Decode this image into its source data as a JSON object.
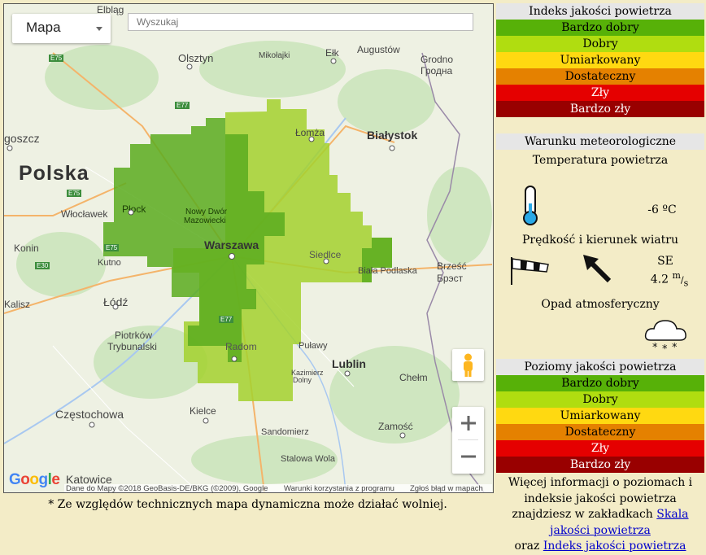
{
  "map": {
    "type_selector": "Mapa",
    "search_placeholder": "Wyszukaj",
    "logo": "Google",
    "attribution": {
      "data": "Dane do Mapy ©2018 GeoBasis-DE/BKG (©2009), Google",
      "terms": "Warunki korzystania z programu",
      "report": "Zgłoś błąd w mapach"
    },
    "places": [
      {
        "id": "elblag",
        "name": "Elbląg"
      },
      {
        "id": "olsztyn",
        "name": "Olsztyn"
      },
      {
        "id": "mikolajki",
        "name": "Mikołajki"
      },
      {
        "id": "elk",
        "name": "Ełk"
      },
      {
        "id": "augustow",
        "name": "Augustów"
      },
      {
        "id": "grodno",
        "name": "Grodno"
      },
      {
        "id": "grodno_by",
        "name": "Гродна"
      },
      {
        "id": "lomza",
        "name": "Łomża"
      },
      {
        "id": "bialystok",
        "name": "Białystok"
      },
      {
        "id": "bydgoszcz",
        "name": "goszcz"
      },
      {
        "id": "polska",
        "name": "Polska"
      },
      {
        "id": "wloclawek",
        "name": "Włocławek"
      },
      {
        "id": "plock",
        "name": "Płock"
      },
      {
        "id": "nowydwor",
        "name": "Nowy Dwór"
      },
      {
        "id": "mazowiecki",
        "name": "Mazowiecki"
      },
      {
        "id": "warszawa",
        "name": "Warszawa"
      },
      {
        "id": "siedlce",
        "name": "Siedlce"
      },
      {
        "id": "biala",
        "name": "Biała Podlaska"
      },
      {
        "id": "brzesc",
        "name": "Brześć"
      },
      {
        "id": "brest",
        "name": "Брэст"
      },
      {
        "id": "konin",
        "name": "Konin"
      },
      {
        "id": "kutno",
        "name": "Kutno"
      },
      {
        "id": "kalisz",
        "name": "Kalisz"
      },
      {
        "id": "lodz",
        "name": "Łódź"
      },
      {
        "id": "piotrkow",
        "name": "Piotrków"
      },
      {
        "id": "trybunalski",
        "name": "Trybunalski"
      },
      {
        "id": "radom",
        "name": "Radom"
      },
      {
        "id": "pulawy",
        "name": "Puławy"
      },
      {
        "id": "kazimierz",
        "name": "Kazimierz"
      },
      {
        "id": "dolny",
        "name": "Dolny"
      },
      {
        "id": "lublin",
        "name": "Lublin"
      },
      {
        "id": "chelm",
        "name": "Chełm"
      },
      {
        "id": "czestochowa",
        "name": "Częstochowa"
      },
      {
        "id": "kielce",
        "name": "Kielce"
      },
      {
        "id": "sandomierz",
        "name": "Sandomierz"
      },
      {
        "id": "zamosc",
        "name": "Zamość"
      },
      {
        "id": "stalowa",
        "name": "Stalowa Wola"
      },
      {
        "id": "katowice",
        "name": "Katowice"
      }
    ],
    "roads": [
      {
        "id": "e75a",
        "name": "E75"
      },
      {
        "id": "e77",
        "name": "E77"
      },
      {
        "id": "e75b",
        "name": "E75"
      },
      {
        "id": "e75c",
        "name": "E75"
      },
      {
        "id": "e30",
        "name": "E30"
      },
      {
        "id": "e77b",
        "name": "E77"
      }
    ],
    "overlay_colors": {
      "very_good": "#5aab1e",
      "good": "#a3d12e"
    }
  },
  "note": "* Ze względów technicznych mapa dynamiczna może działać wolniej.",
  "index_legend": {
    "title": "Indeks jakości powietrza",
    "levels": [
      {
        "label": "Bardzo dobry",
        "color": "#57b108",
        "text": "#000000"
      },
      {
        "label": "Dobry",
        "color": "#b0dd10",
        "text": "#000000"
      },
      {
        "label": "Umiarkowany",
        "color": "#ffd911",
        "text": "#000000"
      },
      {
        "label": "Dostateczny",
        "color": "#e58100",
        "text": "#000000"
      },
      {
        "label": "Zły",
        "color": "#e50000",
        "text": "#ffffff"
      },
      {
        "label": "Bardzo zły",
        "color": "#990000",
        "text": "#ffffff"
      }
    ]
  },
  "weather": {
    "title": "Warunku meteorologiczne",
    "temp_label": "Temperatura powietrza",
    "temp_value": "-6 ºC",
    "wind_label": "Prędkość i kierunek wiatru",
    "wind_dir": "SE",
    "wind_speed": "4.2",
    "wind_unit_num": "m",
    "wind_unit_den": "s",
    "precip_label": "Opad atmosferyczny"
  },
  "levels_legend": {
    "title": "Poziomy jakości powietrza",
    "levels": [
      {
        "label": "Bardzo dobry",
        "color": "#57b108",
        "text": "#000000"
      },
      {
        "label": "Dobry",
        "color": "#b0dd10",
        "text": "#000000"
      },
      {
        "label": "Umiarkowany",
        "color": "#ffd911",
        "text": "#000000"
      },
      {
        "label": "Dostateczny",
        "color": "#e58100",
        "text": "#000000"
      },
      {
        "label": "Zły",
        "color": "#e50000",
        "text": "#ffffff"
      },
      {
        "label": "Bardzo zły",
        "color": "#990000",
        "text": "#ffffff"
      }
    ]
  },
  "info": {
    "line1": "Więcej informacji o poziomach i indeksie jakości powietrza znajdziesz w zakładkach",
    "link1": "Skala jakości powietrza",
    "and": "oraz",
    "link2": "Indeks jakości powietrza"
  }
}
